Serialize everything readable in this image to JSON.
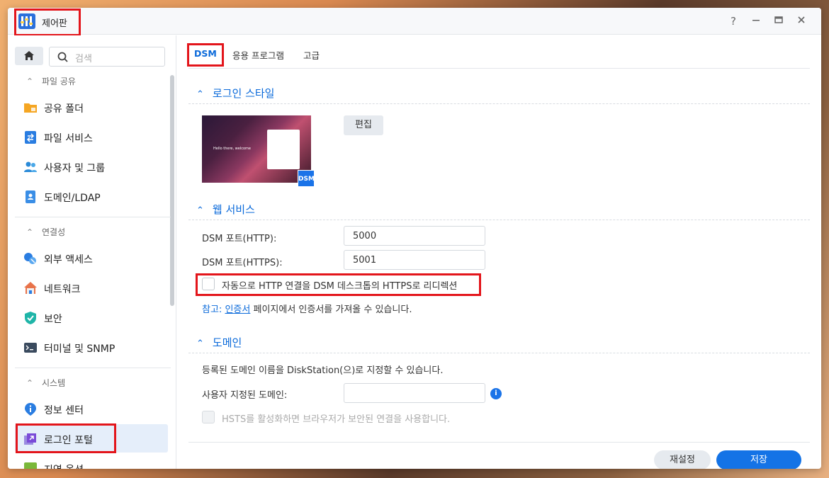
{
  "window": {
    "title": "제어판",
    "controls": {
      "help": "?",
      "minimize": "—",
      "maximize": "□",
      "close": "✕"
    }
  },
  "sidebar": {
    "search_placeholder": "검색",
    "sections": [
      {
        "header": "파일 공유",
        "items": [
          "공유 폴더",
          "파일 서비스",
          "사용자 및 그룹",
          "도메인/LDAP"
        ]
      },
      {
        "header": "연결성",
        "items": [
          "외부 액세스",
          "네트워크",
          "보안",
          "터미널 및 SNMP"
        ]
      },
      {
        "header": "시스템",
        "items": [
          "정보 센터",
          "로그인 포털",
          "지역 옵션"
        ]
      }
    ]
  },
  "tabs": [
    "DSM",
    "응용 프로그램",
    "고급"
  ],
  "login_style": {
    "title": "로그인 스타일",
    "edit_button": "편집",
    "badge": "DSM",
    "preview_text": "Hello there, welcome"
  },
  "web_service": {
    "title": "웹 서비스",
    "http_label": "DSM 포트(HTTP):",
    "http_value": "5000",
    "https_label": "DSM 포트(HTTPS):",
    "https_value": "5001",
    "redirect_label": "자동으로 HTTP 연결을 DSM 데스크톱의 HTTPS로 리디렉션",
    "note_prefix": "참고:",
    "note_link": "인증서",
    "note_suffix": "페이지에서 인증서를 가져올 수 있습니다."
  },
  "domain": {
    "title": "도메인",
    "desc": "등록된 도메인 이름을 DiskStation(으)로 지정할 수 있습니다.",
    "custom_label": "사용자 지정된 도메인:",
    "custom_value": "",
    "info": "i",
    "hsts_label": "HSTS를 활성화하면 브라우저가 보안된 연결을 사용합니다."
  },
  "footer": {
    "reset": "재설정",
    "save": "저장"
  },
  "colors": {
    "accent": "#1473e6",
    "highlight": "#e3151b"
  }
}
